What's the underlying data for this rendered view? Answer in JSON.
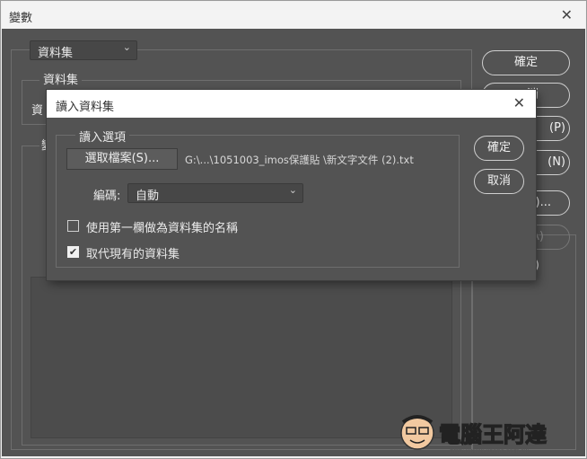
{
  "window": {
    "title": "變數",
    "close_glyph": "✕"
  },
  "background": {
    "dataset_select": "資料集",
    "dataset_group_label": "資料集",
    "dataset_partial_label": "資",
    "variables_partial_label": "變",
    "right_buttons": [
      {
        "label": "確定"
      },
      {
        "label": "消"
      },
      {
        "label": "(P)"
      },
      {
        "label": "(N)"
      },
      {
        "label": "I)..."
      },
      {
        "label": "A)"
      },
      {
        "label": "V)"
      }
    ]
  },
  "dialog": {
    "title": "讀入資料集",
    "close_glyph": "✕",
    "group_label": "讀入選項",
    "choose_file_button": "選取檔案(S)...",
    "file_path": "G:\\...\\1051003_imos保護貼 \\新文字文件 (2).txt",
    "encoding_label": "編碼:",
    "encoding_value": "自動",
    "checkbox_first_column": {
      "label": "使用第一欄做為資料集的名稱",
      "checked": false
    },
    "checkbox_replace": {
      "label": "取代現有的資料集",
      "checked": true
    },
    "ok_button": "確定",
    "cancel_button": "取消"
  },
  "watermark": {
    "text": "電腦王阿達",
    "url": "http://www.kocpc.com.tw"
  },
  "colors": {
    "panel": "#535353",
    "title_bg": "#ffffff",
    "text": "#e6e6e6"
  }
}
